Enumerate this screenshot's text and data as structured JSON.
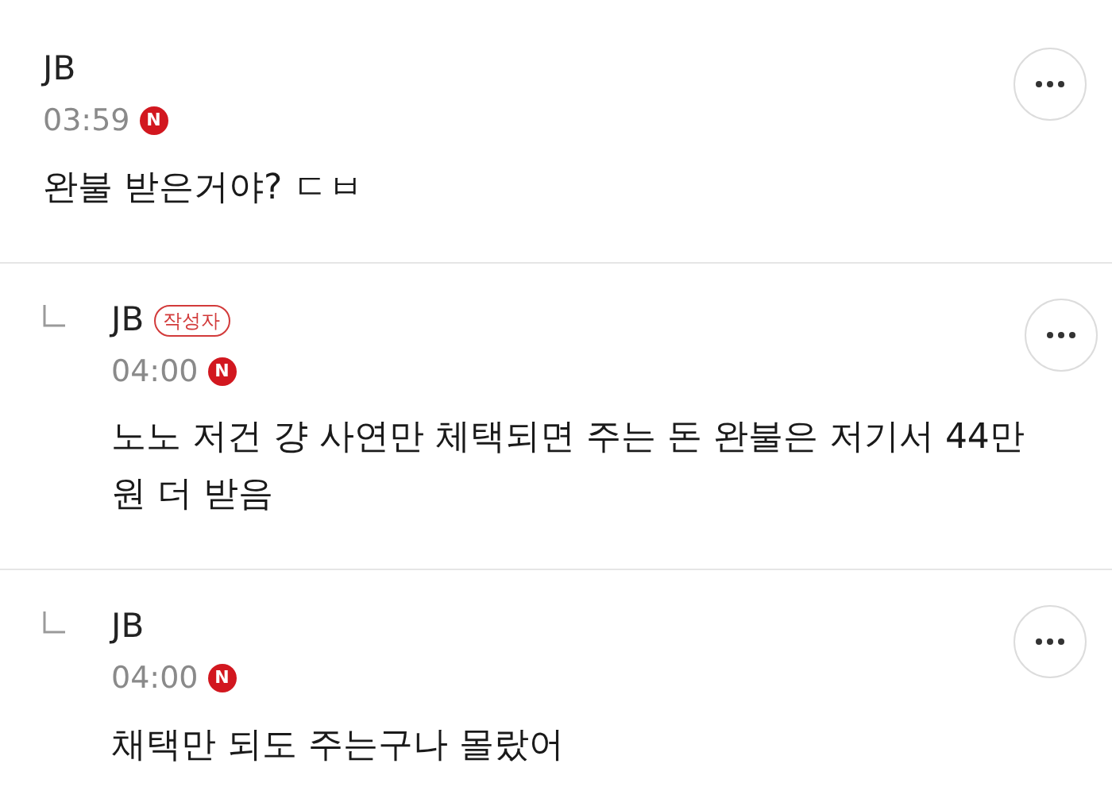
{
  "comments": [
    {
      "kind": "comment",
      "author": "JB",
      "time": "03:59",
      "new_badge": "N",
      "lines": [
        "완불 받은거야? ㄷㅂ"
      ]
    },
    {
      "kind": "reply",
      "author": "JB",
      "author_badge": "작성자",
      "time": "04:00",
      "new_badge": "N",
      "lines": [
        "노노 저건 걍 사연만 체택되면 주는 돈 완불은 저기서 44만",
        "원 더 받음"
      ]
    },
    {
      "kind": "reply",
      "author": "JB",
      "time": "04:00",
      "new_badge": "N",
      "lines": [
        "채택만 되도 주는구나 몰랐어"
      ]
    }
  ]
}
